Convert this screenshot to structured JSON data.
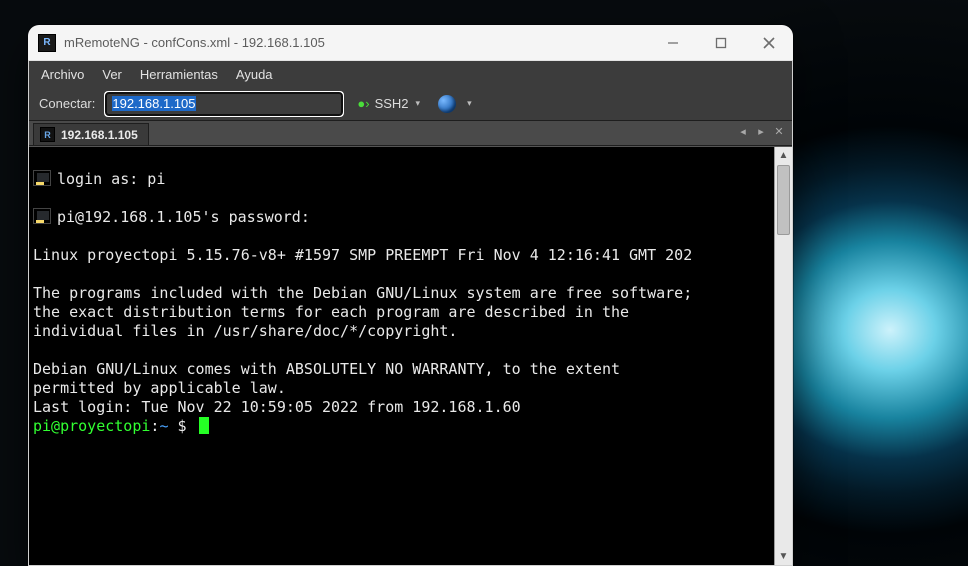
{
  "window": {
    "title": "mRemoteNG - confCons.xml - 192.168.1.105"
  },
  "menubar": {
    "items": [
      "Archivo",
      "Ver",
      "Herramientas",
      "Ayuda"
    ]
  },
  "toolbar": {
    "connect_label": "Conectar:",
    "address_value": "192.168.1.105",
    "protocol_label": "SSH2"
  },
  "tab": {
    "label": "192.168.1.105"
  },
  "terminal": {
    "line1": "login as: pi",
    "line2": "pi@192.168.1.105's password:",
    "kernel": "Linux proyectopi 5.15.76-v8+ #1597 SMP PREEMPT Fri Nov 4 12:16:41 GMT 202",
    "blank1": "",
    "p1": "The programs included with the Debian GNU/Linux system are free software;",
    "p2": "the exact distribution terms for each program are described in the",
    "p3": "individual files in /usr/share/doc/*/copyright.",
    "blank2": "",
    "w1": "Debian GNU/Linux comes with ABSOLUTELY NO WARRANTY, to the extent",
    "w2": "permitted by applicable law.",
    "lastlogin": "Last login: Tue Nov 22 10:59:05 2022 from 192.168.1.60",
    "prompt_user": "pi@proyectopi",
    "prompt_sep": ":",
    "prompt_path": "~",
    "prompt_sym": " $ "
  }
}
